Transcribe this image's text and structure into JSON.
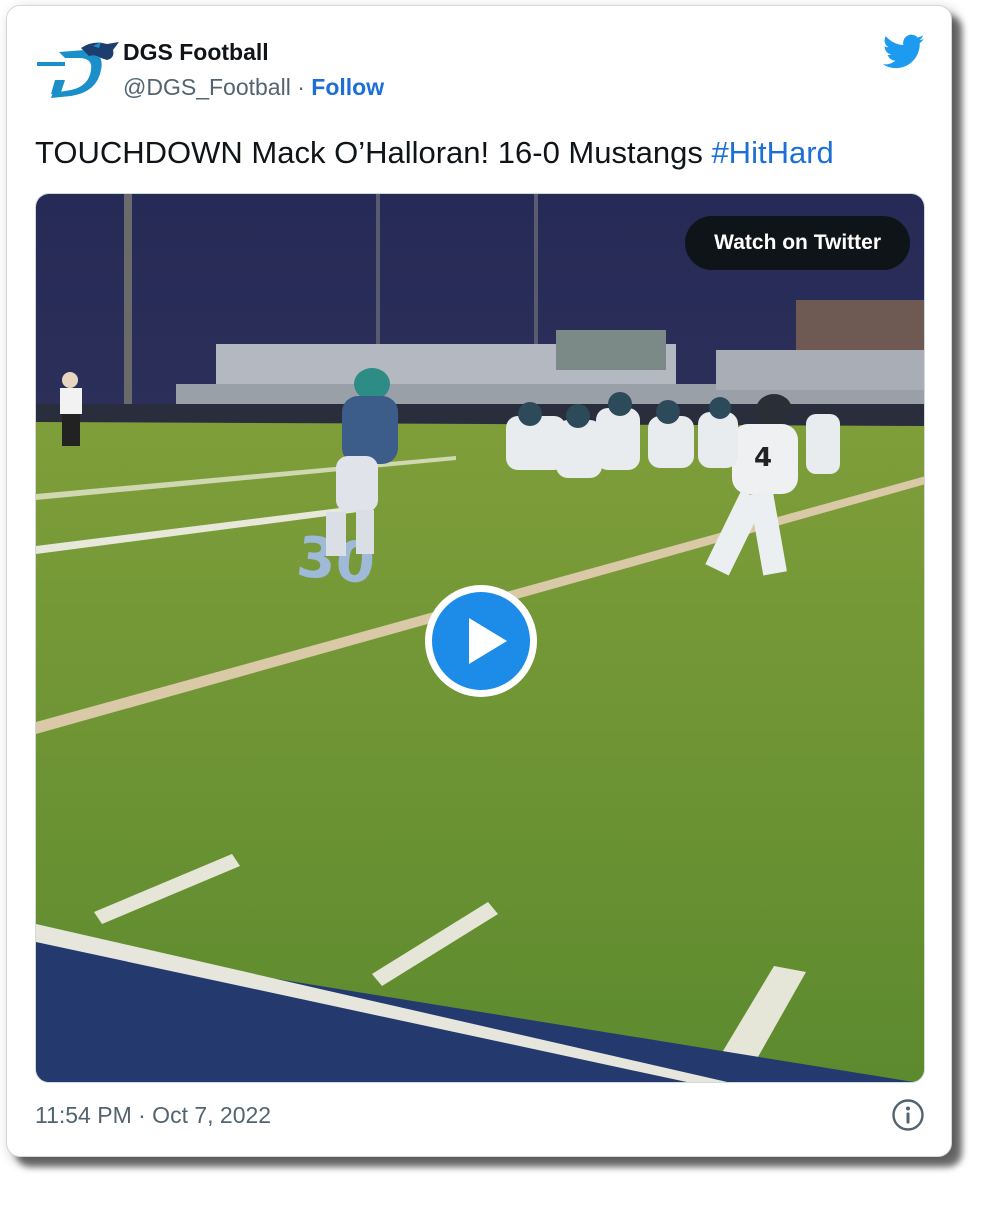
{
  "tweet": {
    "display_name": "DGS Football",
    "handle": "@DGS_Football",
    "separator": "·",
    "follow_label": "Follow",
    "text": "TOUCHDOWN Mack O’Halloran! 16-0 Mustangs ",
    "hashtag": "#HitHard",
    "timestamp": "11:54 PM · Oct 7, 2022"
  },
  "media": {
    "watch_label": "Watch on Twitter",
    "field_number": "30",
    "jersey_number": "4"
  },
  "icons": {
    "avatar": "mustang-logo-icon",
    "brand": "twitter-bird-icon",
    "play": "play-icon",
    "info": "info-icon"
  },
  "colors": {
    "link": "#1d6fd8",
    "twitter_blue": "#1d9bf0",
    "play_button": "#1d8be8",
    "watch_button_bg": "#0f1419"
  }
}
